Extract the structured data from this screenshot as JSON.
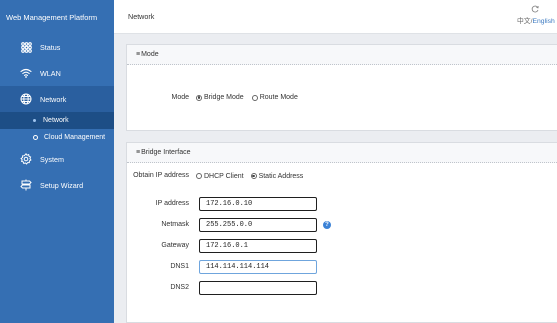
{
  "app": {
    "title": "Web Management Platform"
  },
  "sidebar": {
    "items": [
      {
        "label": "Status",
        "icon": "status-grid-icon"
      },
      {
        "label": "WLAN",
        "icon": "wifi-icon"
      },
      {
        "label": "Network",
        "icon": "globe-icon"
      },
      {
        "label": "System",
        "icon": "gear-icon"
      },
      {
        "label": "Setup Wizard",
        "icon": "signpost-icon"
      }
    ],
    "subitems": [
      {
        "label": "Network"
      },
      {
        "label": "Cloud Management"
      }
    ]
  },
  "header": {
    "title": "Network",
    "lang_zh": "中文/",
    "lang_en": "English"
  },
  "mode_section": {
    "title": "Mode",
    "label": "Mode",
    "options": [
      "Bridge Mode",
      "Route Mode"
    ],
    "selected": "Bridge Mode"
  },
  "bridge_section": {
    "title": "Bridge Interface",
    "obtain_ip": {
      "label": "Obtain IP address",
      "options": [
        "DHCP Client",
        "Static Address"
      ],
      "selected": "Static Address"
    },
    "ip_address": {
      "label": "IP address",
      "value": "172.16.0.10"
    },
    "netmask": {
      "label": "Netmask",
      "value": "255.255.0.0"
    },
    "gateway": {
      "label": "Gateway",
      "value": "172.16.0.1"
    },
    "dns1": {
      "label": "DNS1",
      "value": "114.114.114.114"
    },
    "dns2": {
      "label": "DNS2",
      "value": ""
    }
  },
  "colors": {
    "sidebar": "#356fb3",
    "sidebar_active": "#2a5f9f",
    "sidebar_selected": "#1d4e86",
    "accent": "#3b82d6"
  }
}
